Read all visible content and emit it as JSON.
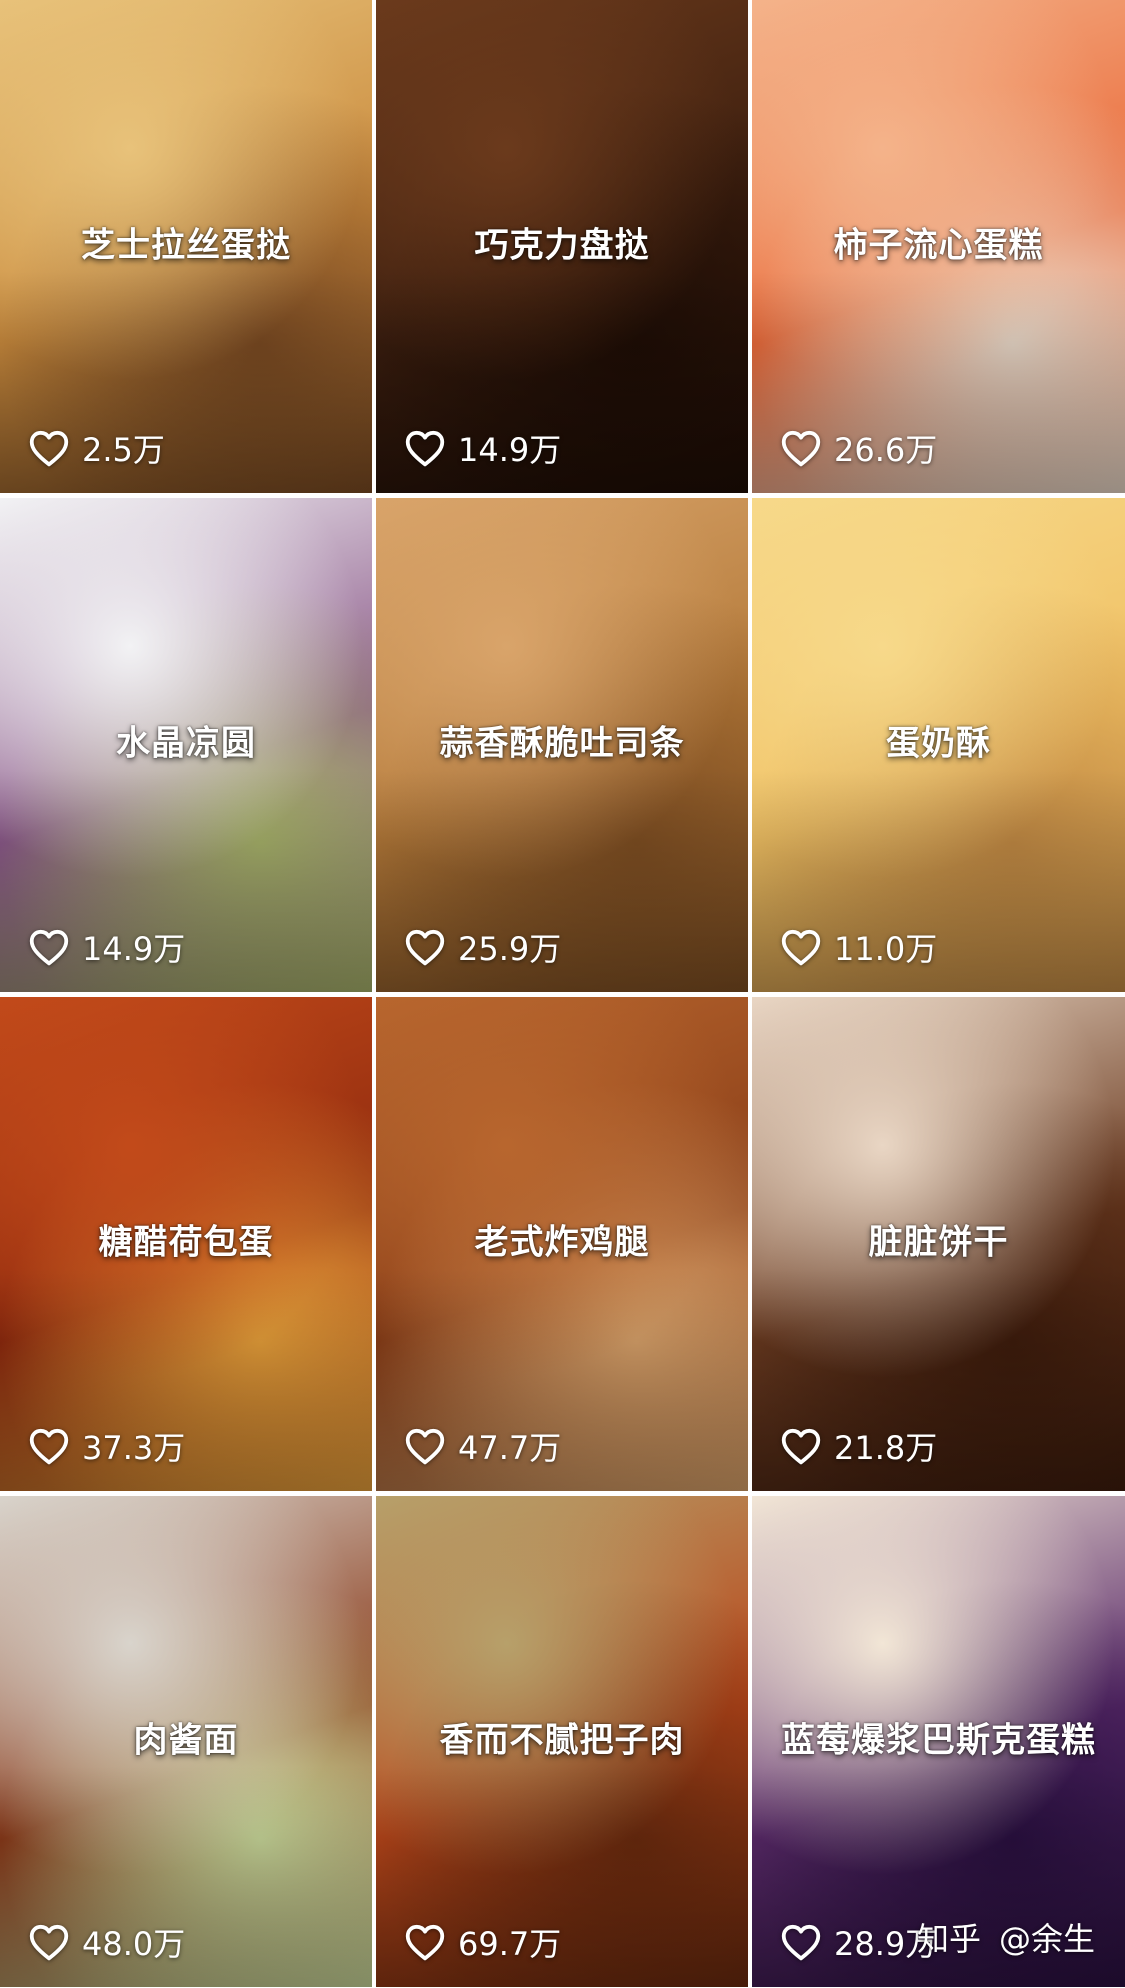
{
  "tiles": [
    {
      "title": "芝士拉丝蛋挞",
      "likes": "2.5万",
      "colors": [
        "#e8c27a",
        "#c98a3d",
        "#7a4a22"
      ]
    },
    {
      "title": "巧克力盘挞",
      "likes": "14.9万",
      "colors": [
        "#6b3a1c",
        "#3a1d0e",
        "#1e0d05"
      ]
    },
    {
      "title": "柿子流心蛋糕",
      "likes": "26.6万",
      "colors": [
        "#f4b38a",
        "#ea6a3a",
        "#e9d8c8"
      ]
    },
    {
      "title": "水晶凉圆",
      "likes": "14.9万",
      "colors": [
        "#f2f2f4",
        "#8c5a8a",
        "#a7b26a"
      ]
    },
    {
      "title": "蒜香酥脆吐司条",
      "likes": "25.9万",
      "colors": [
        "#d9a46a",
        "#b27838",
        "#7e4e22"
      ]
    },
    {
      "title": "蛋奶酥",
      "likes": "11.0万",
      "colors": [
        "#f7d98a",
        "#f0c063",
        "#c28a44"
      ]
    },
    {
      "title": "糖醋荷包蛋",
      "likes": "37.3万",
      "colors": [
        "#c24a1a",
        "#8f2a0e",
        "#e8a03a"
      ]
    },
    {
      "title": "老式炸鸡腿",
      "likes": "47.7万",
      "colors": [
        "#b8662e",
        "#8a3e18",
        "#d9a26a"
      ]
    },
    {
      "title": "脏脏饼干",
      "likes": "21.8万",
      "colors": [
        "#e9d6c4",
        "#6a3a20",
        "#3e1c0c"
      ]
    },
    {
      "title": "肉酱面",
      "likes": "48.0万",
      "colors": [
        "#d9d4cc",
        "#8a3a1a",
        "#c9d89a"
      ]
    },
    {
      "title": "香而不腻把子肉",
      "likes": "69.7万",
      "colors": [
        "#b7a06a",
        "#b8461a",
        "#6a2a0e"
      ]
    },
    {
      "title": "蓝莓爆浆巴斯克蛋糕",
      "likes": "28.9万",
      "colors": [
        "#f2e6d6",
        "#5a2a6a",
        "#2a1040"
      ]
    }
  ],
  "watermark": {
    "brand": "知乎",
    "author": "@余生"
  },
  "icons": {
    "like": "heart-outline-icon"
  }
}
